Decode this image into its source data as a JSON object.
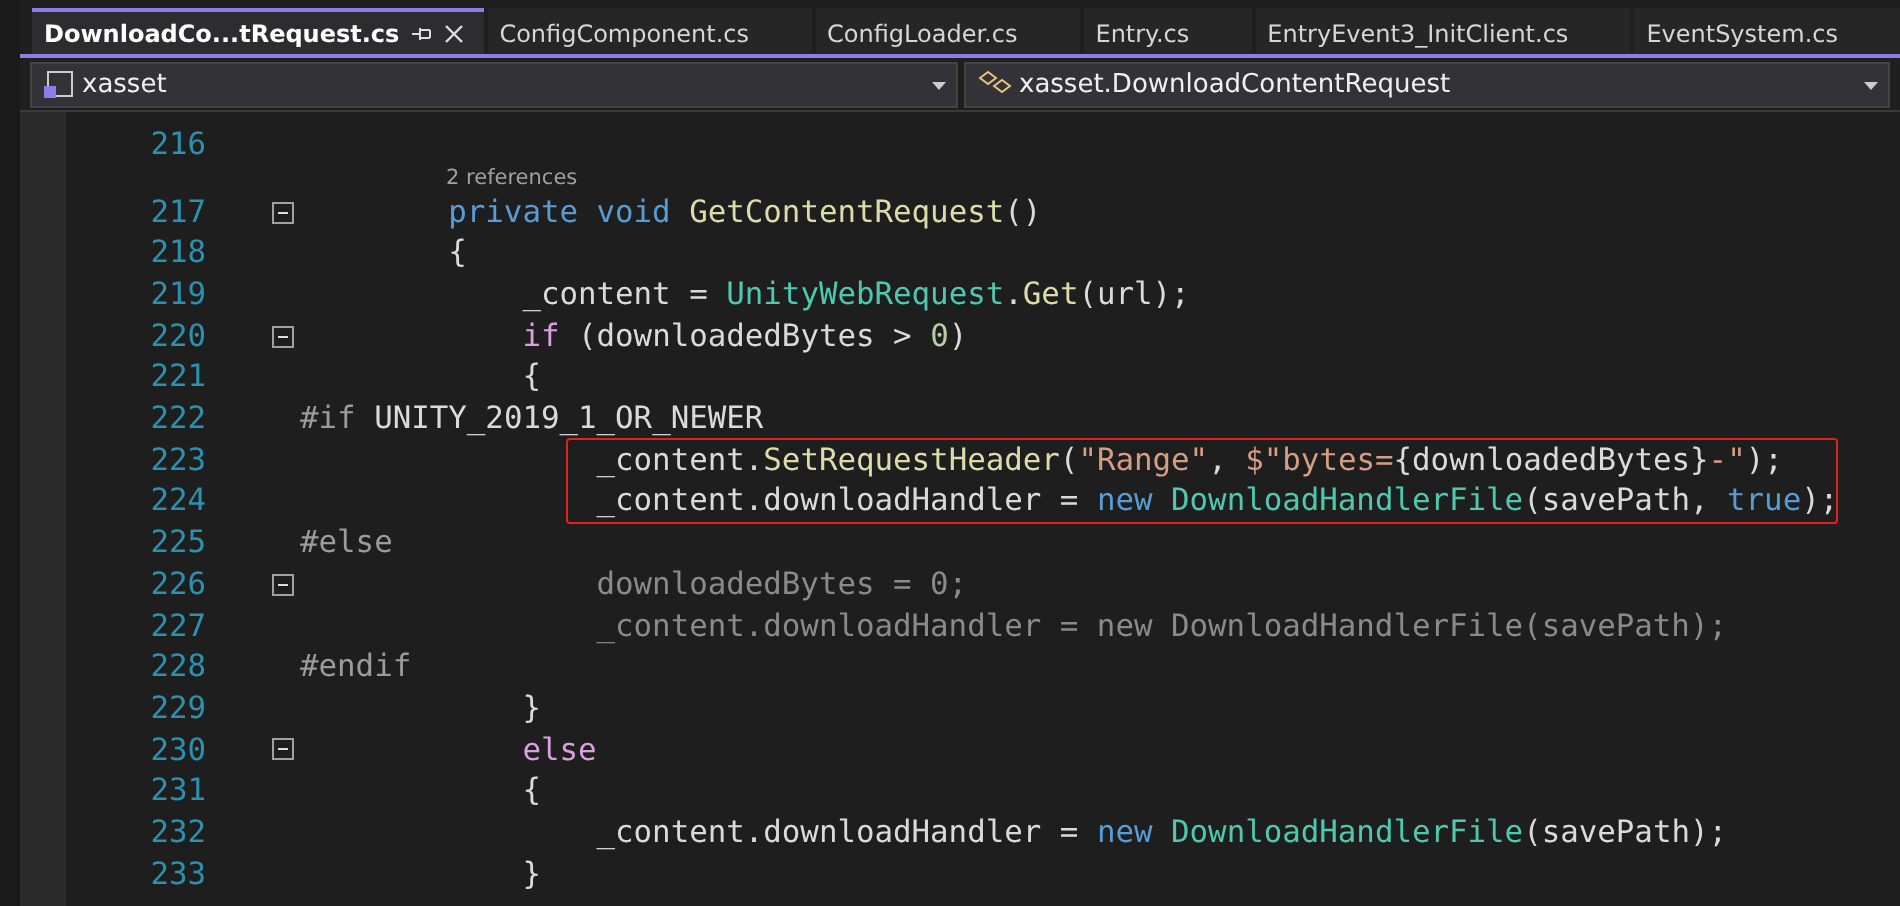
{
  "tabs": [
    {
      "label": "DownloadCo...tRequest.cs",
      "selected": true,
      "pinnable": true,
      "closable": true
    },
    {
      "label": "ConfigComponent.cs",
      "selected": false,
      "pinnable": false,
      "closable": false
    },
    {
      "label": "ConfigLoader.cs",
      "selected": false,
      "pinnable": false,
      "closable": false
    },
    {
      "label": "Entry.cs",
      "selected": false,
      "pinnable": false,
      "closable": false
    },
    {
      "label": "EntryEvent3_InitClient.cs",
      "selected": false,
      "pinnable": false,
      "closable": false
    },
    {
      "label": "EventSystem.cs",
      "selected": false,
      "pinnable": false,
      "closable": false
    }
  ],
  "navigation": [
    {
      "kind": "project",
      "value": "xasset"
    },
    {
      "kind": "class",
      "value": "xasset.DownloadContentRequest"
    }
  ],
  "code_lines": [
    {
      "number": "216",
      "fold": false,
      "highlighted": false
    },
    {
      "number": "217",
      "fold": true,
      "highlighted": false,
      "codelens": "2 references",
      "tokens": [
        {
          "text": "        private void ",
          "kind": "keyword"
        },
        {
          "text": "GetContentRequest",
          "kind": "method"
        },
        {
          "text": "()",
          "kind": "plain"
        }
      ]
    },
    {
      "number": "218",
      "fold": false,
      "highlighted": false,
      "tokens": [
        {
          "text": "        {",
          "kind": "plain"
        }
      ]
    },
    {
      "number": "219",
      "fold": false,
      "highlighted": false,
      "tokens": [
        {
          "text": "            _content = ",
          "kind": "plain"
        },
        {
          "text": "UnityWebRequest",
          "kind": "type"
        },
        {
          "text": ".",
          "kind": "plain"
        },
        {
          "text": "Get",
          "kind": "method"
        },
        {
          "text": "(url);",
          "kind": "plain"
        }
      ]
    },
    {
      "number": "220",
      "fold": true,
      "highlighted": false,
      "tokens": [
        {
          "text": "            if",
          "kind": "control"
        },
        {
          "text": " (downloadedBytes > ",
          "kind": "plain"
        },
        {
          "text": "0",
          "kind": "number"
        },
        {
          "text": ")",
          "kind": "plain"
        }
      ]
    },
    {
      "number": "221",
      "fold": false,
      "highlighted": false,
      "tokens": [
        {
          "text": "            {",
          "kind": "plain"
        }
      ]
    },
    {
      "number": "222",
      "fold": false,
      "highlighted": false,
      "tokens": [
        {
          "text": "#if",
          "kind": "preprocessor"
        },
        {
          "text": " UNITY_2019_1_OR_NEWER",
          "kind": "plain"
        }
      ]
    },
    {
      "number": "223",
      "fold": false,
      "highlighted": true,
      "tokens": [
        {
          "text": "                _content.",
          "kind": "plain"
        },
        {
          "text": "SetRequestHeader",
          "kind": "method"
        },
        {
          "text": "(",
          "kind": "plain"
        },
        {
          "text": "\"Range\"",
          "kind": "string"
        },
        {
          "text": ", ",
          "kind": "plain"
        },
        {
          "text": "$\"bytes=",
          "kind": "string"
        },
        {
          "text": "{downloadedBytes}",
          "kind": "plain"
        },
        {
          "text": "-\"",
          "kind": "string"
        },
        {
          "text": ");",
          "kind": "plain"
        }
      ]
    },
    {
      "number": "224",
      "fold": false,
      "highlighted": true,
      "tokens": [
        {
          "text": "                _content.downloadHandler = ",
          "kind": "plain"
        },
        {
          "text": "new ",
          "kind": "keyword"
        },
        {
          "text": "DownloadHandlerFile",
          "kind": "type"
        },
        {
          "text": "(savePath, ",
          "kind": "plain"
        },
        {
          "text": "true",
          "kind": "keyword"
        },
        {
          "text": ");",
          "kind": "plain"
        }
      ]
    },
    {
      "number": "225",
      "fold": false,
      "highlighted": false,
      "tokens": [
        {
          "text": "#else",
          "kind": "preprocessor"
        }
      ]
    },
    {
      "number": "226",
      "fold": true,
      "highlighted": false,
      "tokens": [
        {
          "text": "                downloadedBytes = 0;",
          "kind": "inactive"
        }
      ]
    },
    {
      "number": "227",
      "fold": false,
      "highlighted": false,
      "tokens": [
        {
          "text": "                _content.downloadHandler = new DownloadHandlerFile(savePath);",
          "kind": "inactive"
        }
      ]
    },
    {
      "number": "228",
      "fold": false,
      "highlighted": false,
      "tokens": [
        {
          "text": "#endif",
          "kind": "preprocessor"
        }
      ]
    },
    {
      "number": "229",
      "fold": false,
      "highlighted": false,
      "tokens": [
        {
          "text": "            }",
          "kind": "plain"
        }
      ]
    },
    {
      "number": "230",
      "fold": true,
      "highlighted": false,
      "tokens": [
        {
          "text": "            else",
          "kind": "control"
        }
      ]
    },
    {
      "number": "231",
      "fold": false,
      "highlighted": false,
      "tokens": [
        {
          "text": "            {",
          "kind": "plain"
        }
      ]
    },
    {
      "number": "232",
      "fold": false,
      "highlighted": false,
      "tokens": [
        {
          "text": "                _content.downloadHandler = ",
          "kind": "plain"
        },
        {
          "text": "new ",
          "kind": "keyword"
        },
        {
          "text": "DownloadHandlerFile",
          "kind": "type"
        },
        {
          "text": "(savePath);",
          "kind": "plain"
        }
      ]
    },
    {
      "number": "233",
      "fold": false,
      "highlighted": false,
      "tokens": [
        {
          "text": "            }",
          "kind": "plain"
        }
      ]
    }
  ]
}
